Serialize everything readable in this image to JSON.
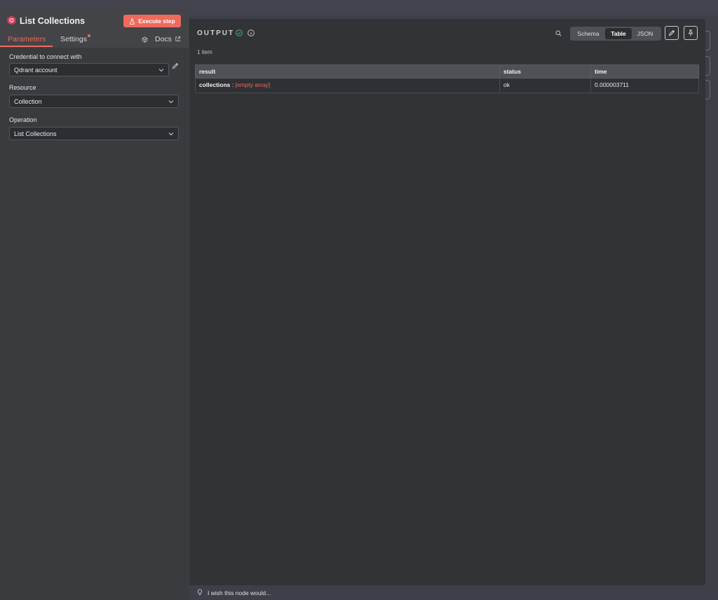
{
  "node": {
    "title": "List Collections",
    "execute_label": "Execute step"
  },
  "tabs": {
    "parameters": "Parameters",
    "settings": "Settings",
    "docs": "Docs"
  },
  "params": {
    "credential_label": "Credential to connect with",
    "credential_value": "Qdrant account",
    "resource_label": "Resource",
    "resource_value": "Collection",
    "operation_label": "Operation",
    "operation_value": "List Collections"
  },
  "output": {
    "title": "OUTPUT",
    "views": {
      "schema": "Schema",
      "table": "Table",
      "json": "JSON"
    },
    "selected_view": "Table",
    "item_count": "1 item",
    "columns": [
      "result",
      "status",
      "time"
    ],
    "rows": [
      {
        "result_key": "collections",
        "result_sep": " : ",
        "result_value": "[empty array]",
        "status": "ok",
        "time": "0.000003711"
      }
    ]
  },
  "footer": {
    "wish_text": "I wish this node would..."
  },
  "colors": {
    "accent": "#ef6a5b",
    "success": "#3fb37a"
  }
}
